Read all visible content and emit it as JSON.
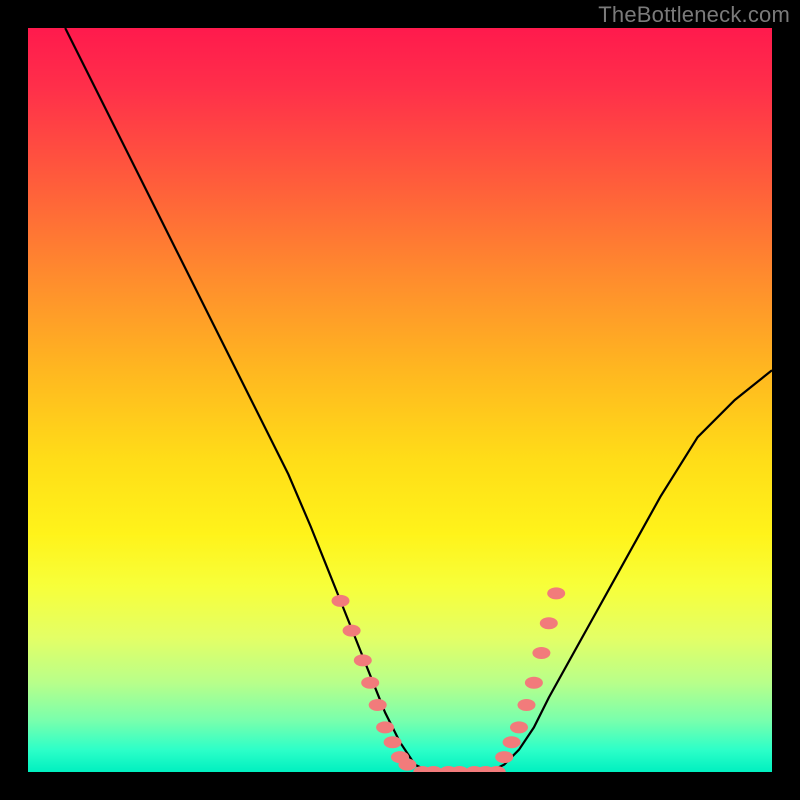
{
  "watermark": "TheBottleneck.com",
  "colors": {
    "curve_stroke": "#000000",
    "marker_fill": "#f27b7b",
    "marker_stroke": "#f27b7b",
    "frame": "#000000"
  },
  "chart_data": {
    "type": "line",
    "title": "",
    "xlabel": "",
    "ylabel": "",
    "xlim": [
      0,
      100
    ],
    "ylim": [
      0,
      100
    ],
    "grid": false,
    "legend": false,
    "series": [
      {
        "name": "bottleneck-curve",
        "x": [
          5,
          10,
          15,
          20,
          25,
          30,
          35,
          38,
          40,
          42,
          44,
          46,
          48,
          50,
          52,
          54,
          56,
          58,
          60,
          62,
          64,
          66,
          68,
          70,
          75,
          80,
          85,
          90,
          95,
          100
        ],
        "y": [
          100,
          90,
          80,
          70,
          60,
          50,
          40,
          33,
          28,
          23,
          18,
          13,
          8,
          4,
          1,
          0,
          0,
          0,
          0,
          0,
          1,
          3,
          6,
          10,
          19,
          28,
          37,
          45,
          50,
          54
        ]
      }
    ],
    "markers": [
      {
        "series": "zone-left",
        "x": [
          42.0,
          43.5,
          45.0,
          46.0,
          47.0,
          48.0,
          49.0,
          50.0,
          51.0
        ],
        "y": [
          23,
          19,
          15,
          12,
          9,
          6,
          4,
          2,
          1
        ]
      },
      {
        "series": "zone-floor",
        "x": [
          53.0,
          54.5,
          56.5,
          58.0,
          60.0,
          61.5,
          63.0
        ],
        "y": [
          0,
          0,
          0,
          0,
          0,
          0,
          0
        ]
      },
      {
        "series": "zone-right",
        "x": [
          64.0,
          65.0,
          66.0,
          67.0,
          68.0,
          69.0,
          70.0,
          71.0
        ],
        "y": [
          2,
          4,
          6,
          9,
          12,
          16,
          20,
          24
        ]
      }
    ]
  }
}
